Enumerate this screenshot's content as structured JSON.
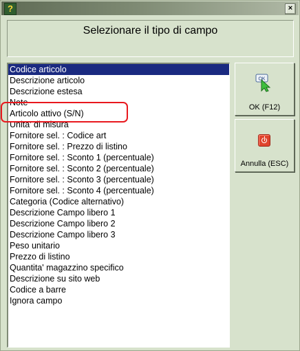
{
  "window": {
    "close_glyph": "×"
  },
  "header": {
    "title": "Selezionare il tipo di campo"
  },
  "list": {
    "selected_index": 0,
    "highlighted_index": 4,
    "items": [
      "Codice articolo",
      "Descrizione articolo",
      "Descrizione estesa",
      "Note",
      "Articolo attivo (S/N)",
      "Unita' di misura",
      "Fornitore sel. : Codice art",
      "Fornitore sel. : Prezzo di listino",
      "Fornitore sel. : Sconto 1 (percentuale)",
      "Fornitore sel. : Sconto 2 (percentuale)",
      "Fornitore sel. : Sconto 3 (percentuale)",
      "Fornitore sel. : Sconto 4 (percentuale)",
      "Categoria (Codice alternativo)",
      "Descrizione Campo libero 1",
      "Descrizione Campo libero 2",
      "Descrizione Campo libero 3",
      "Peso unitario",
      "Prezzo di listino",
      "Quantita' magazzino specifico",
      "Descrizione su sito web",
      "Codice a barre",
      "Ignora campo"
    ]
  },
  "buttons": {
    "ok": {
      "label": "OK (F12)",
      "icon_text": "OK"
    },
    "cancel": {
      "label": "Annulla (ESC)"
    }
  },
  "colors": {
    "selection": "#1a2a80",
    "highlight_ring": "#e8171d",
    "dialog_bg": "#d7e2cc"
  }
}
